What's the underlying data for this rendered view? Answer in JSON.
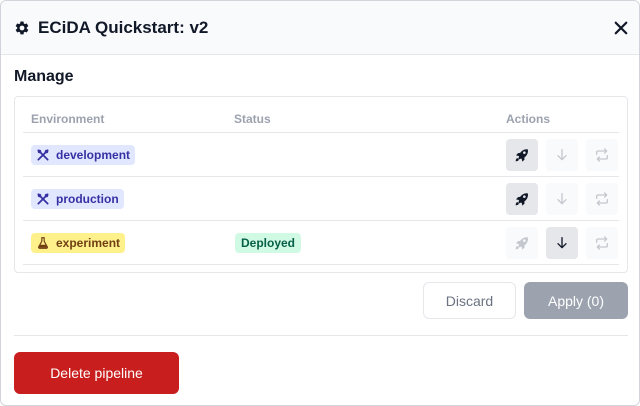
{
  "dialog": {
    "title": "ECiDA Quickstart: v2",
    "icons": {
      "title_icon": "gear-icon",
      "close_icon": "close-icon"
    }
  },
  "manage": {
    "heading": "Manage",
    "columns": {
      "environment": "Environment",
      "status": "Status",
      "actions": "Actions"
    },
    "rows": [
      {
        "environment": "development",
        "env_icon": "tools-icon",
        "status": "",
        "deploy_enabled": true,
        "pull_enabled": false,
        "sync_enabled": false
      },
      {
        "environment": "production",
        "env_icon": "tools-icon",
        "status": "",
        "deploy_enabled": true,
        "pull_enabled": false,
        "sync_enabled": false
      },
      {
        "environment": "experiment",
        "env_icon": "flask-icon",
        "status": "Deployed",
        "deploy_enabled": false,
        "pull_enabled": true,
        "sync_enabled": false
      }
    ]
  },
  "footer": {
    "discard_label": "Discard",
    "apply_label": "Apply (0)",
    "delete_label": "Delete pipeline"
  },
  "colors": {
    "env_badge_bg": "#e0e7ff",
    "experiment_badge_bg": "#fef08a",
    "deployed_badge_bg": "#d1fae5",
    "delete_button": "#c81e1e",
    "apply_button_disabled": "#9ca3af"
  }
}
